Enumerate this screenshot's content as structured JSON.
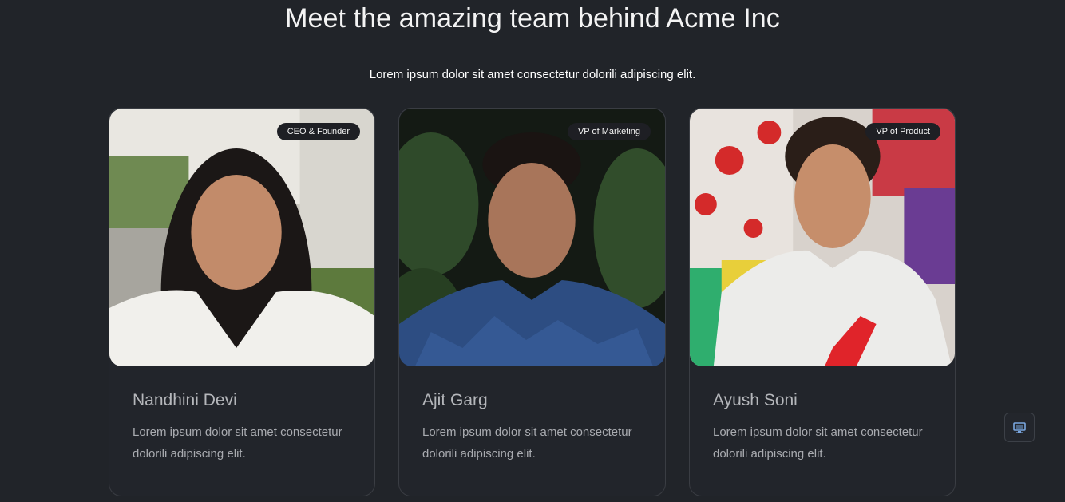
{
  "header": {
    "title": "Meet the amazing team behind Acme Inc",
    "subtitle": "Lorem ipsum dolor sit amet consectetur dolorili adipiscing elit."
  },
  "team": [
    {
      "name": "Nandhini Devi",
      "role": "CEO & Founder",
      "description": "Lorem ipsum dolor sit amet consectetur dolorili adipiscing elit."
    },
    {
      "name": "Ajit Garg",
      "role": "VP of Marketing",
      "description": "Lorem ipsum dolor sit amet consectetur dolorili adipiscing elit."
    },
    {
      "name": "Ayush Soni",
      "role": "VP of Product",
      "description": "Lorem ipsum dolor sit amet consectetur dolorili adipiscing elit."
    }
  ],
  "floating_button": {
    "icon": "monitor-icon"
  },
  "colors": {
    "background": "#212429",
    "card_border": "#3a3d43",
    "badge_bg": "#1e1f24",
    "name_text": "#b5b7bb",
    "icon_accent": "#7aa7e0"
  }
}
